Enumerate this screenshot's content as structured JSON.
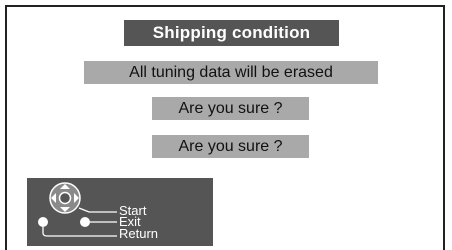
{
  "dialog": {
    "title": "Shipping condition",
    "messages": [
      "All tuning data will be erased",
      "Are you sure ?",
      "Are you sure ?"
    ]
  },
  "legend": {
    "start_label": "Start",
    "exit_label": "Exit",
    "return_label": "Return",
    "icons": [
      "directional-pad-icon",
      "exit-button-icon",
      "return-button-icon"
    ]
  }
}
